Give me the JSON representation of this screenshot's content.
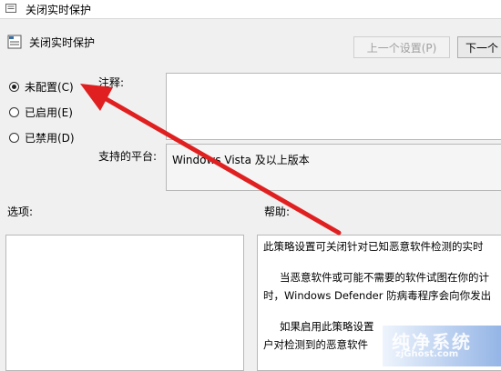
{
  "window": {
    "title": "关闭实时保护"
  },
  "header": {
    "title": "关闭实时保护"
  },
  "nav": {
    "prev_label": "上一个设置(P)",
    "next_label": "下一个"
  },
  "radios": [
    {
      "label": "未配置(C)",
      "checked": true
    },
    {
      "label": "已启用(E)",
      "checked": false
    },
    {
      "label": "已禁用(D)",
      "checked": false
    }
  ],
  "comment": {
    "label": "注释:",
    "value": ""
  },
  "platform": {
    "label": "支持的平台:",
    "value": "Windows Vista 及以上版本"
  },
  "options": {
    "label": "选项:"
  },
  "help": {
    "label": "帮助:",
    "lines": [
      "此策略设置可关闭针对已知恶意软件检测的实时",
      "当恶意软件或可能不需要的软件试图在你的计",
      "时，Windows Defender 防病毒程序会向你发出",
      "如果启用此策略设置",
      "户对检测到的恶意软件"
    ]
  },
  "watermark": {
    "text": "纯净系统",
    "sub": "zjGhost.com"
  },
  "colors": {
    "annotation_arrow": "#e02020"
  }
}
